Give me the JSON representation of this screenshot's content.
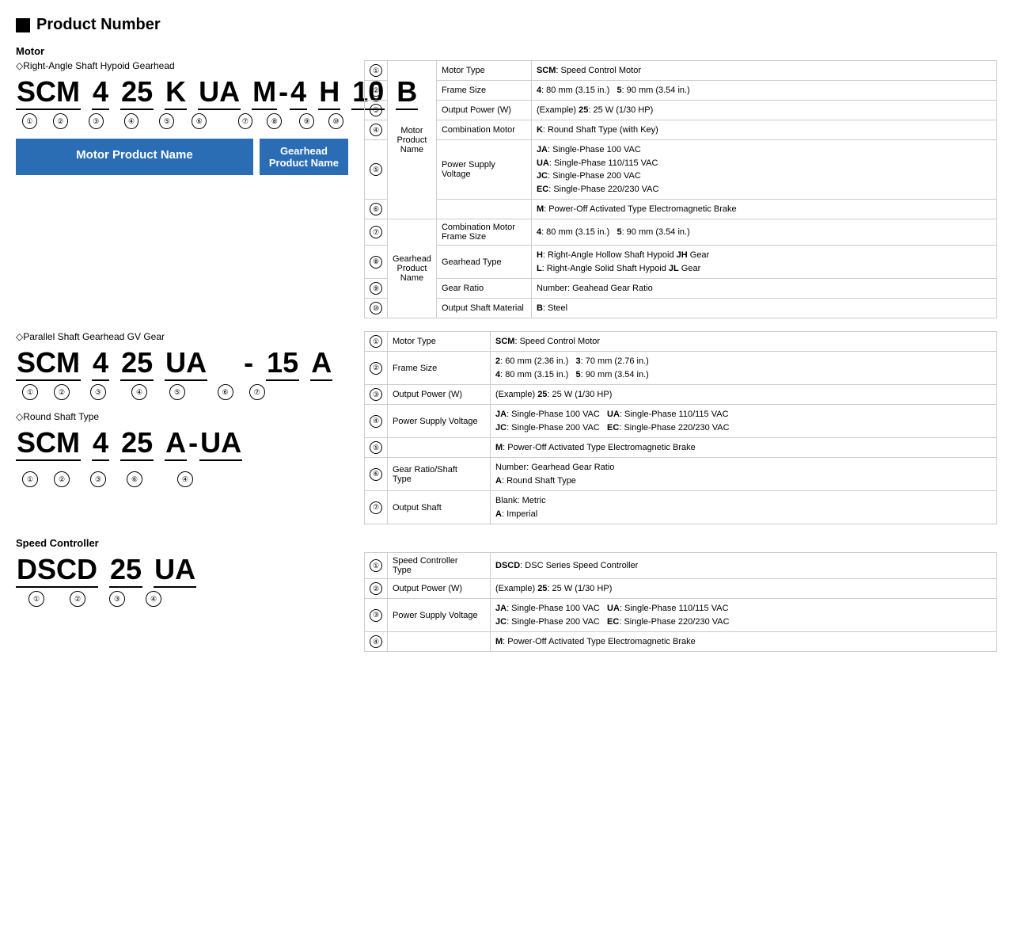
{
  "page": {
    "main_title": "Product Number",
    "motor_label": "Motor",
    "speed_controller_label": "Speed Controller",
    "sections": {
      "right_angle": {
        "diamond_label": "Right-Angle Shaft Hypoid Gearhead",
        "code_parts": [
          "SCM",
          "4",
          "25",
          "K",
          "UA",
          "M",
          "-",
          "4",
          "H",
          "10",
          "B"
        ],
        "code_numbers": [
          "①",
          "②",
          "③",
          "④",
          "⑤",
          "⑥",
          "",
          "⑦",
          "⑧",
          "⑨",
          "⑩"
        ],
        "motor_product_name": "Motor Product Name",
        "gearhead_product_name": "Gearhead\nProduct Name",
        "table": {
          "rows": [
            {
              "circle": "①",
              "category": "Motor\nProduct\nName",
              "rowspan_cat": 6,
              "field": "Motor Type",
              "value": "SCM: Speed Control Motor"
            },
            {
              "circle": "②",
              "field": "Frame Size",
              "value": "4: 80 mm (3.15 in.)    5: 90 mm (3.54 in.)"
            },
            {
              "circle": "③",
              "field": "Output Power (W)",
              "value": "(Example) 25: 25 W (1/30 HP)"
            },
            {
              "circle": "④",
              "field": "Combination Motor",
              "value": "K: Round Shaft Type (with Key)"
            },
            {
              "circle": "⑤",
              "field": "Power Supply Voltage",
              "value": "JA: Single-Phase 100 VAC\nUA: Single-Phase 110/115 VAC\nJC: Single-Phase 200 VAC\nEC: Single-Phase 220/230 VAC"
            },
            {
              "circle": "⑥",
              "field": "",
              "value": "M: Power-Off Activated Type Electromagnetic Brake"
            },
            {
              "circle": "⑦",
              "category": "Gearhead\nProduct\nName",
              "rowspan_cat": 4,
              "field": "Combination Motor\nFrame Size",
              "value": "4: 80 mm (3.15 in.)    5: 90 mm (3.54 in.)"
            },
            {
              "circle": "⑧",
              "field": "Gearhead Type",
              "value": "H: Right-Angle Hollow Shaft Hypoid JH Gear\nL: Right-Angle Solid Shaft Hypoid JL Gear"
            },
            {
              "circle": "⑨",
              "field": "Gear Ratio",
              "value": "Number: Geahead Gear Ratio"
            },
            {
              "circle": "⑩",
              "field": "Output Shaft Material",
              "value": "B: Steel"
            }
          ]
        }
      },
      "parallel": {
        "diamond_label": "Parallel Shaft Gearhead GV Gear",
        "code_parts": [
          "SCM",
          "4",
          "25",
          "UA",
          "",
          "-",
          "15",
          "A"
        ],
        "code_numbers": [
          "①",
          "②",
          "③",
          "④",
          "⑤",
          "",
          "⑥",
          "⑦"
        ],
        "table": {
          "rows": [
            {
              "circle": "①",
              "field": "Motor Type",
              "value": "SCM: Speed Control Motor"
            },
            {
              "circle": "②",
              "field": "Frame Size",
              "value": "2: 60 mm (2.36 in.)    3: 70 mm (2.76 in.)\n4: 80 mm (3.15 in.)    5: 90 mm (3.54 in.)"
            },
            {
              "circle": "③",
              "field": "Output Power (W)",
              "value": "(Example) 25: 25 W (1/30 HP)"
            },
            {
              "circle": "④",
              "field": "Power Supply Voltage",
              "value": "JA: Single-Phase 100 VAC    UA: Single-Phase 110/115 VAC\nJC: Single-Phase 200 VAC    EC: Single-Phase 220/230 VAC"
            },
            {
              "circle": "⑤",
              "field": "",
              "value": "M: Power-Off Activated Type Electromagnetic Brake"
            },
            {
              "circle": "⑥",
              "field": "Gear Ratio/Shaft\nType",
              "value": "Number: Gearhead Gear Ratio\nA: Round Shaft Type"
            },
            {
              "circle": "⑦",
              "field": "Output Shaft",
              "value": "Blank: Metric\nA: Imperial"
            }
          ]
        }
      },
      "round_shaft": {
        "diamond_label": "Round Shaft Type",
        "code_parts": [
          "SCM",
          "4",
          "25",
          "A",
          "-",
          "UA"
        ],
        "code_numbers": [
          "①",
          "②",
          "③",
          "⑥",
          "",
          "④"
        ]
      },
      "speed_controller": {
        "code_parts": [
          "DSCD",
          "25",
          "UA"
        ],
        "code_numbers": [
          "①",
          "②",
          "③",
          "④"
        ],
        "table": {
          "rows": [
            {
              "circle": "①",
              "field": "Speed Controller\nType",
              "value": "DSCD: DSC Series Speed Controller"
            },
            {
              "circle": "②",
              "field": "Output Power (W)",
              "value": "(Example) 25: 25 W (1/30 HP)"
            },
            {
              "circle": "③",
              "field": "Power Supply Voltage",
              "value": "JA: Single-Phase 100 VAC    UA: Single-Phase 110/115 VAC\nJC: Single-Phase 200 VAC    EC: Single-Phase 220/230 VAC"
            },
            {
              "circle": "④",
              "field": "",
              "value": "M: Power-Off Activated Type Electromagnetic Brake"
            }
          ]
        }
      }
    }
  }
}
